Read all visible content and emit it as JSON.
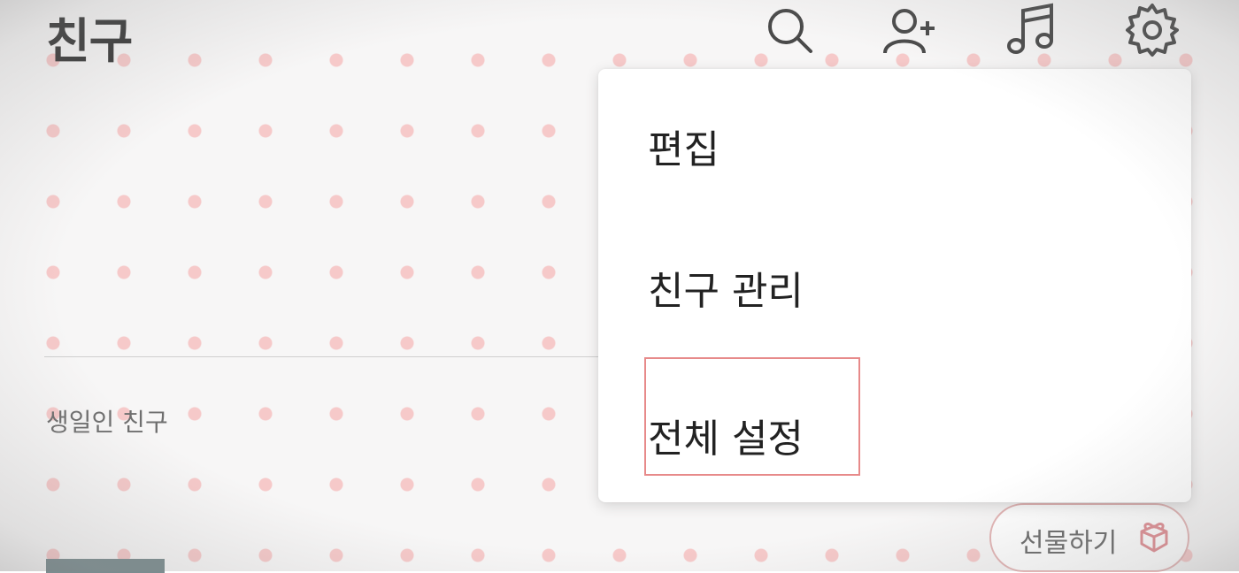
{
  "header": {
    "title": "친구",
    "icons": [
      "search-icon",
      "add-friend-icon",
      "music-icon",
      "settings-icon"
    ]
  },
  "main": {
    "section_label": "생일인 친구",
    "gift_button_label": "선물하기",
    "gift_icon": "gift-icon"
  },
  "menu": {
    "items": [
      {
        "label": "편집"
      },
      {
        "label": "친구 관리"
      },
      {
        "label": "전체 설정"
      }
    ],
    "highlighted_index": 2
  },
  "colors": {
    "text_dark": "#3a3a3a",
    "highlight_border": "#e78a8a",
    "gift_border": "#e3b5b5",
    "gift_icon": "#e08f94",
    "polka_dot": "#f6c9c9"
  }
}
